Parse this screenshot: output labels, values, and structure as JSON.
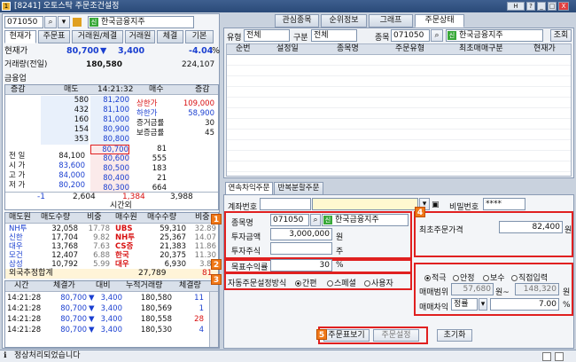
{
  "title": "[8241] 오토스탁 주문조건설정",
  "title_buttons": [
    "H",
    "?",
    "_",
    "□",
    "X"
  ],
  "code": "071050",
  "stock_name": "한국금융지주",
  "left_tabs": [
    "현재가",
    "주문표",
    "거래원/체결",
    "거래원",
    "체결",
    "기본"
  ],
  "price_label": "현재가",
  "price": "80,700",
  "change": "3,400",
  "rate": "-4.04",
  "vol_label": "거래량(전일)",
  "volume": "180,580",
  "prev_volume": "224,107",
  "industry": "금융업",
  "ob_headers": [
    "증감",
    "매도",
    "14:21:32",
    "매수",
    "증감"
  ],
  "asks": [
    [
      "580",
      "81,200"
    ],
    [
      "432",
      "81,100"
    ],
    [
      "160",
      "81,000"
    ],
    [
      "154",
      "80,900"
    ],
    [
      "353",
      "80,800"
    ]
  ],
  "bids": [
    [
      "80,700",
      "81"
    ],
    [
      "80,600",
      "555"
    ],
    [
      "80,500",
      "183"
    ],
    [
      "80,400",
      "21"
    ],
    [
      "80,300",
      "664"
    ]
  ],
  "info_right": [
    [
      "상한가",
      "109,000"
    ],
    [
      "하한가",
      "58,900"
    ],
    [
      "증거금률",
      "30"
    ],
    [
      "보증금률",
      "45"
    ]
  ],
  "info_left": [
    [
      "전 일",
      "84,100"
    ],
    [
      "시 가",
      "83,600"
    ],
    [
      "고 가",
      "84,000"
    ],
    [
      "저 가",
      "80,200"
    ]
  ],
  "ob_total": [
    "-1",
    "2,604",
    "1,384",
    "3,988"
  ],
  "ob_time_label": "시간외",
  "broker_headers": [
    "매도원",
    "매도수량",
    "비중",
    "매수원",
    "매수수량",
    "비중"
  ],
  "brokers": [
    [
      "NH투",
      "32,058",
      "17.78",
      "UBS",
      "59,310",
      "32.89"
    ],
    [
      "신한",
      "17,704",
      "9.82",
      "NH투",
      "25,367",
      "14.07"
    ],
    [
      "대우",
      "13,768",
      "7.63",
      "CS증",
      "21,383",
      "11.86"
    ],
    [
      "모건",
      "12,407",
      "6.88",
      "한국",
      "20,375",
      "11.30"
    ],
    [
      "삼성",
      "10,792",
      "5.99",
      "대우",
      "6,930",
      "3.84"
    ]
  ],
  "foreign_label": "외국추정합계",
  "foreign_val": "27,789",
  "foreign_val2": "81",
  "tick_headers": [
    "시간",
    "체결가",
    "대비",
    "누적거래량",
    "체결량"
  ],
  "ticks": [
    [
      "14:21:28",
      "80,700",
      "3,400",
      "180,580",
      "11"
    ],
    [
      "14:21:28",
      "80,700",
      "3,400",
      "180,569",
      "1"
    ],
    [
      "14:21:28",
      "80,700",
      "3,400",
      "180,558",
      "28"
    ],
    [
      "14:21:28",
      "80,700",
      "3,400",
      "180,530",
      "4"
    ]
  ],
  "right_tabs": [
    "관심종목",
    "순위정보",
    "그래프",
    "주문상태"
  ],
  "filter": {
    "type_label": "유형",
    "type": "전체",
    "gubun_label": "구분",
    "gubun": "전체",
    "code_label": "종목",
    "code": "071050",
    "name": "한국금융지주",
    "lookup": "조회"
  },
  "grid_headers": [
    "순번",
    "설정일",
    "종목명",
    "주문유형",
    "최초매매구분",
    "현재가"
  ],
  "order_tabs": [
    "연속차익주문",
    "반복분할주문"
  ],
  "account_label": "계좌번호",
  "password_label": "비밀번호",
  "password": "****",
  "form": {
    "stock_label": "종목명",
    "code": "071050",
    "name": "한국금융지주",
    "amount_label": "투자금액",
    "amount": "3,000,000",
    "amount_unit": "원",
    "shares_label": "투자주식",
    "shares_unit": "주",
    "target_label": "목표수익률",
    "target": "30",
    "target_unit": "%",
    "auto_label": "자동주문설정방식",
    "auto_opts": [
      "간편",
      "스페셜",
      "사용자"
    ]
  },
  "first_price_label": "최초주문가격",
  "first_price": "82,400",
  "first_price_unit": "원",
  "price_opts": [
    "적극",
    "안정",
    "보수",
    "직접입력"
  ],
  "range_label": "매매범위",
  "range_low": "57,680",
  "range_mid": "원~",
  "range_high": "148,320",
  "range_unit": "원",
  "diff_label": "매매차익",
  "diff_sel": "정률",
  "diff_val": "7.00",
  "diff_unit": "%",
  "buttons": [
    "주문표보기",
    "주문설정",
    "초기화"
  ],
  "badges": [
    "1",
    "2",
    "3",
    "4",
    "5"
  ],
  "status": "정상처리되었습니다"
}
